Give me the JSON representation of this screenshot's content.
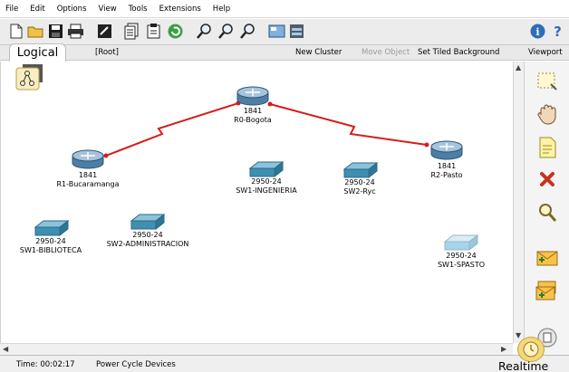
{
  "menu": [
    "File",
    "Edit",
    "Options",
    "View",
    "Tools",
    "Extensions",
    "Help"
  ],
  "toolbar_icons": [
    "new-file-icon",
    "open-folder-icon",
    "save-icon",
    "print-icon",
    "activity-wizard-icon",
    "copy-icon",
    "paste-icon",
    "undo-icon",
    "zoom-in-icon",
    "zoom-reset-icon",
    "zoom-out-icon",
    "palette-icon",
    "custom-device-icon",
    "info-icon",
    "help-icon"
  ],
  "logical": {
    "tab": "Logical",
    "root": "[Root]",
    "new_cluster": "New Cluster",
    "move_object": "Move Object",
    "set_tiled_background": "Set Tiled Background",
    "viewport": "Viewport"
  },
  "devices": {
    "r0": {
      "model": "1841",
      "name": "R0-Bogota"
    },
    "r1": {
      "model": "1841",
      "name": "R1-Bucaramanga"
    },
    "r2": {
      "model": "1841",
      "name": "R2-Pasto"
    },
    "sw_ing": {
      "model": "2950-24",
      "name": "SW1-INGENIERIA"
    },
    "sw_ryc": {
      "model": "2950-24",
      "name": "SW2-Ryc"
    },
    "sw_bib": {
      "model": "2950-24",
      "name": "SW1-BIBLIOTECA"
    },
    "sw_adm": {
      "model": "2950-24",
      "name": "SW2-ADMINISTRACION"
    },
    "sw_spasto": {
      "model": "2950-24",
      "name": "SW1-SPASTO"
    }
  },
  "right_tools": [
    "select-icon",
    "move-hand-icon",
    "note-icon",
    "delete-icon",
    "inspect-icon",
    "add-simple-pdu-icon",
    "add-complex-pdu-icon"
  ],
  "status": {
    "time": "Time: 00:02:17",
    "power_cycle": "Power Cycle Devices",
    "mode": "Realtime"
  },
  "colors": {
    "link": "#d81c1c",
    "router": "#4d7fa6",
    "switch": "#3f8fb0",
    "switch_faded": "#a9d3e6"
  }
}
